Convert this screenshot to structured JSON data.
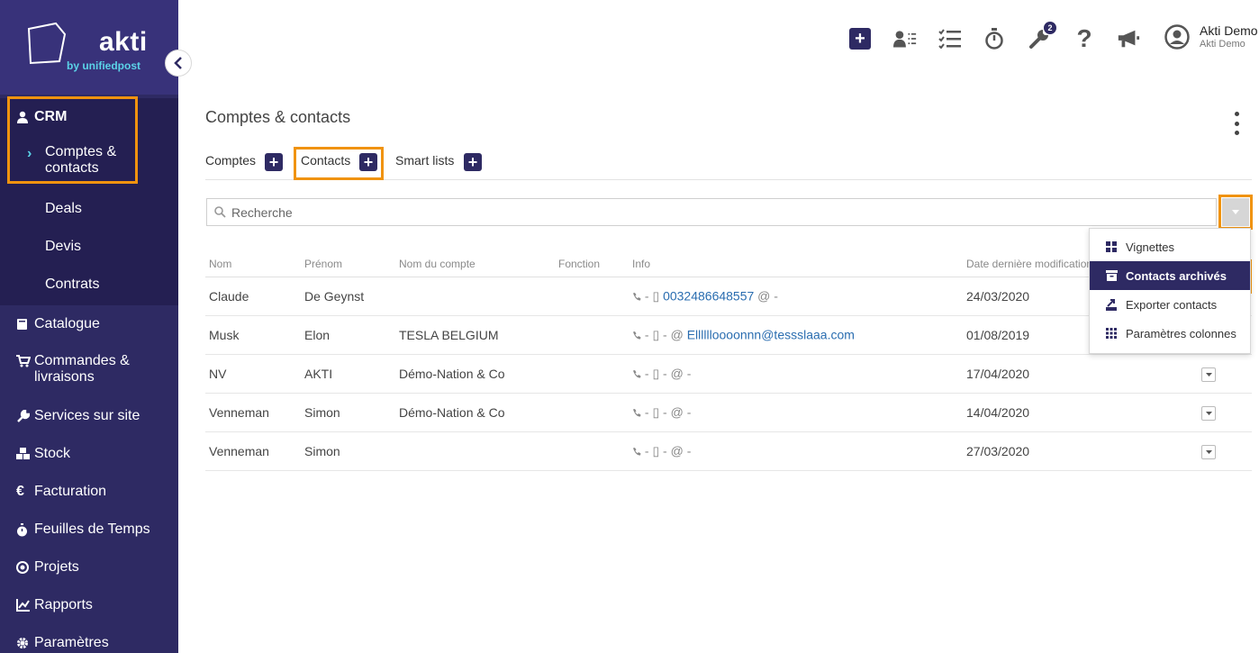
{
  "app": {
    "brand": "akti",
    "brand_sub": "by unifiedpost"
  },
  "sidebar": {
    "crm_label": "CRM",
    "crm_items": [
      {
        "label": "Comptes &",
        "label2": "contacts",
        "active": true
      },
      {
        "label": "Deals"
      },
      {
        "label": "Devis"
      },
      {
        "label": "Contrats"
      }
    ],
    "items": [
      {
        "label": "Catalogue",
        "icon": "book-icon"
      },
      {
        "label": "Commandes &",
        "label2": "livraisons",
        "icon": "cart-icon"
      },
      {
        "label": "Services sur site",
        "icon": "wrench-icon"
      },
      {
        "label": "Stock",
        "icon": "boxes-icon"
      },
      {
        "label": "Facturation",
        "icon": "euro-icon"
      },
      {
        "label": "Feuilles de Temps",
        "icon": "stopwatch-icon"
      },
      {
        "label": "Projets",
        "icon": "target-icon"
      },
      {
        "label": "Rapports",
        "icon": "chart-icon"
      },
      {
        "label": "Paramètres",
        "icon": "gear-icon"
      }
    ]
  },
  "topbar": {
    "tools_badge": "2",
    "user_name": "Akti Demo",
    "user_company": "Akti Demo"
  },
  "page": {
    "title": "Comptes & contacts",
    "tabs": [
      {
        "label": "Comptes"
      },
      {
        "label": "Contacts",
        "active": true
      },
      {
        "label": "Smart lists"
      }
    ],
    "search_placeholder": "Recherche"
  },
  "table": {
    "columns": [
      "Nom",
      "Prénom",
      "Nom du compte",
      "Fonction",
      "Info",
      "Date dernière modification"
    ],
    "rows": [
      {
        "nom": "Claude",
        "prenom": "De Geynst",
        "compte": "",
        "fonction": "",
        "phone": "0032486648557",
        "email": "",
        "date": "24/03/2020"
      },
      {
        "nom": "Musk",
        "prenom": "Elon",
        "compte": "TESLA BELGIUM",
        "fonction": "",
        "phone": "",
        "email": "Elllllloooonnn@tessslaaa.com",
        "date": "01/08/2019"
      },
      {
        "nom": "NV",
        "prenom": "AKTI",
        "compte": "Démo-Nation & Co",
        "fonction": "",
        "phone": "",
        "email": "",
        "date": "17/04/2020"
      },
      {
        "nom": "Venneman",
        "prenom": "Simon",
        "compte": "Démo-Nation & Co",
        "fonction": "",
        "phone": "",
        "email": "",
        "date": "14/04/2020"
      },
      {
        "nom": "Venneman",
        "prenom": "Simon",
        "compte": "",
        "fonction": "",
        "phone": "",
        "email": "",
        "date": "27/03/2020"
      }
    ]
  },
  "dropdown": {
    "items": [
      {
        "label": "Vignettes",
        "icon": "grid-icon"
      },
      {
        "label": "Contacts archivés",
        "icon": "archive-icon",
        "active": true
      },
      {
        "label": "Exporter contacts",
        "icon": "export-icon"
      },
      {
        "label": "Paramètres colonnes",
        "icon": "columns-icon"
      }
    ]
  },
  "colors": {
    "sidebar_bg": "#2e2a63",
    "accent": "#5bd3e8",
    "highlight": "#f0930f",
    "link": "#2a6db0"
  }
}
